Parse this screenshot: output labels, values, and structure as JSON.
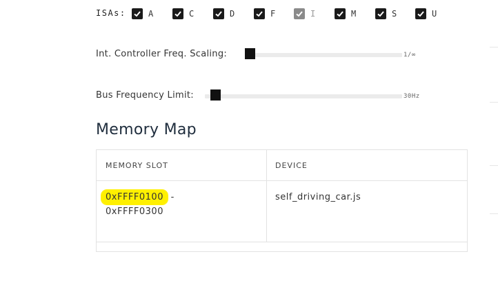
{
  "isa": {
    "label": "ISAs:",
    "items": [
      {
        "letter": "A",
        "checked": true,
        "disabled": false
      },
      {
        "letter": "C",
        "checked": true,
        "disabled": false
      },
      {
        "letter": "D",
        "checked": true,
        "disabled": false
      },
      {
        "letter": "F",
        "checked": true,
        "disabled": false
      },
      {
        "letter": "I",
        "checked": true,
        "disabled": true
      },
      {
        "letter": "M",
        "checked": true,
        "disabled": false
      },
      {
        "letter": "S",
        "checked": true,
        "disabled": false
      },
      {
        "letter": "U",
        "checked": true,
        "disabled": false
      }
    ]
  },
  "sliders": {
    "freq_scaling": {
      "label": "Int. Controller Freq. Scaling:",
      "value": "1/∞",
      "level": 0
    },
    "bus_limit": {
      "label": "Bus Frequency Limit:",
      "value": "30Hz",
      "level": 0
    }
  },
  "memory_map": {
    "title": "Memory Map",
    "headers": {
      "slot": "MEMORY SLOT",
      "device": "DEVICE"
    },
    "rows": [
      {
        "slot_start": "0xFFFF0100",
        "slot_sep": " -",
        "slot_end": "0xFFFF0300",
        "device": "self_driving_car.js"
      }
    ]
  },
  "colors": {
    "highlight": "#fff000",
    "checkbox": "#1a1a1a",
    "checkbox_disabled": "#8a8a8a"
  }
}
